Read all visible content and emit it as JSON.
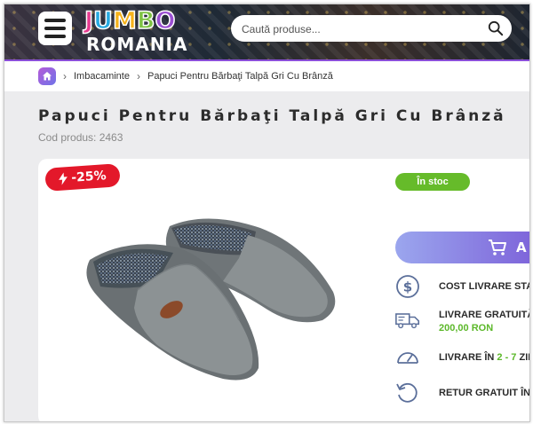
{
  "header": {
    "logo_top": "JUMBO",
    "logo_bottom": "ROMANIA",
    "search_placeholder": "Caută produse...",
    "accent": "#8a4fd8"
  },
  "breadcrumb": {
    "home_icon": "home-icon",
    "items": [
      "Imbacaminte",
      "Papuci Pentru Bărbaţi Talpă Gri Cu Brânză"
    ]
  },
  "product": {
    "title": "Papuci Pentru Bărbaţi Talpă Gri Cu Brânză",
    "code_label": "Cod produs: 2463",
    "discount": "-25%",
    "stock": "În stoc",
    "add_to_cart": "A",
    "features": [
      {
        "icon": "dollar-icon",
        "line1": "COST LIVRARE STAN",
        "line2": ""
      },
      {
        "icon": "truck-icon",
        "line1": "LIVRARE GRATUITĂ",
        "line2": "200,00 RON"
      },
      {
        "icon": "speedometer-icon",
        "line1_a": "LIVRARE ÎN ",
        "line1_b": "2 - 7",
        "line1_c": " ZIL"
      },
      {
        "icon": "return-icon",
        "line1": "RETUR GRATUIT ÎN"
      }
    ]
  },
  "colors": {
    "discount_bg": "#e3182a",
    "stock_bg": "#66bb2a",
    "button_gradient": [
      "#9ba6ee",
      "#7b5ed8"
    ]
  }
}
